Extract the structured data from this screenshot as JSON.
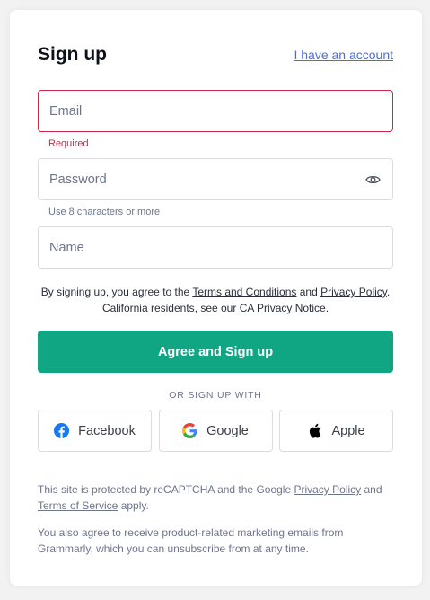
{
  "header": {
    "title": "Sign up",
    "account_link": "I have an account"
  },
  "form": {
    "email": {
      "placeholder": "Email",
      "value": "",
      "error": "Required"
    },
    "password": {
      "placeholder": "Password",
      "value": "",
      "hint": "Use 8 characters or more",
      "toggle_icon": "eye-icon"
    },
    "name": {
      "placeholder": "Name",
      "value": ""
    }
  },
  "terms": {
    "prefix": "By signing up, you agree to the ",
    "terms_link": "Terms and Conditions",
    "and": " and ",
    "privacy_link": "Privacy Policy",
    "middle": ". California residents, see our ",
    "ca_link": "CA Privacy Notice",
    "suffix": "."
  },
  "submit": {
    "label": "Agree and Sign up",
    "color": "#11a683"
  },
  "social": {
    "divider": "OR SIGN UP WITH",
    "buttons": [
      {
        "label": "Facebook",
        "icon": "facebook-icon",
        "color": "#1877f2"
      },
      {
        "label": "Google",
        "icon": "google-icon"
      },
      {
        "label": "Apple",
        "icon": "apple-icon",
        "color": "#000000"
      }
    ]
  },
  "footer": {
    "recaptcha_prefix": "This site is protected by reCAPTCHA and the Google ",
    "recaptcha_privacy_link": "Privacy Policy",
    "recaptcha_and": " and ",
    "recaptcha_terms_link": "Terms of Service",
    "recaptcha_suffix": " apply.",
    "marketing": "You also agree to receive product-related marketing emails from Grammarly, which you can unsubscribe from at any time."
  },
  "colors": {
    "error": "#c8294a",
    "link": "#4a6ee0"
  }
}
